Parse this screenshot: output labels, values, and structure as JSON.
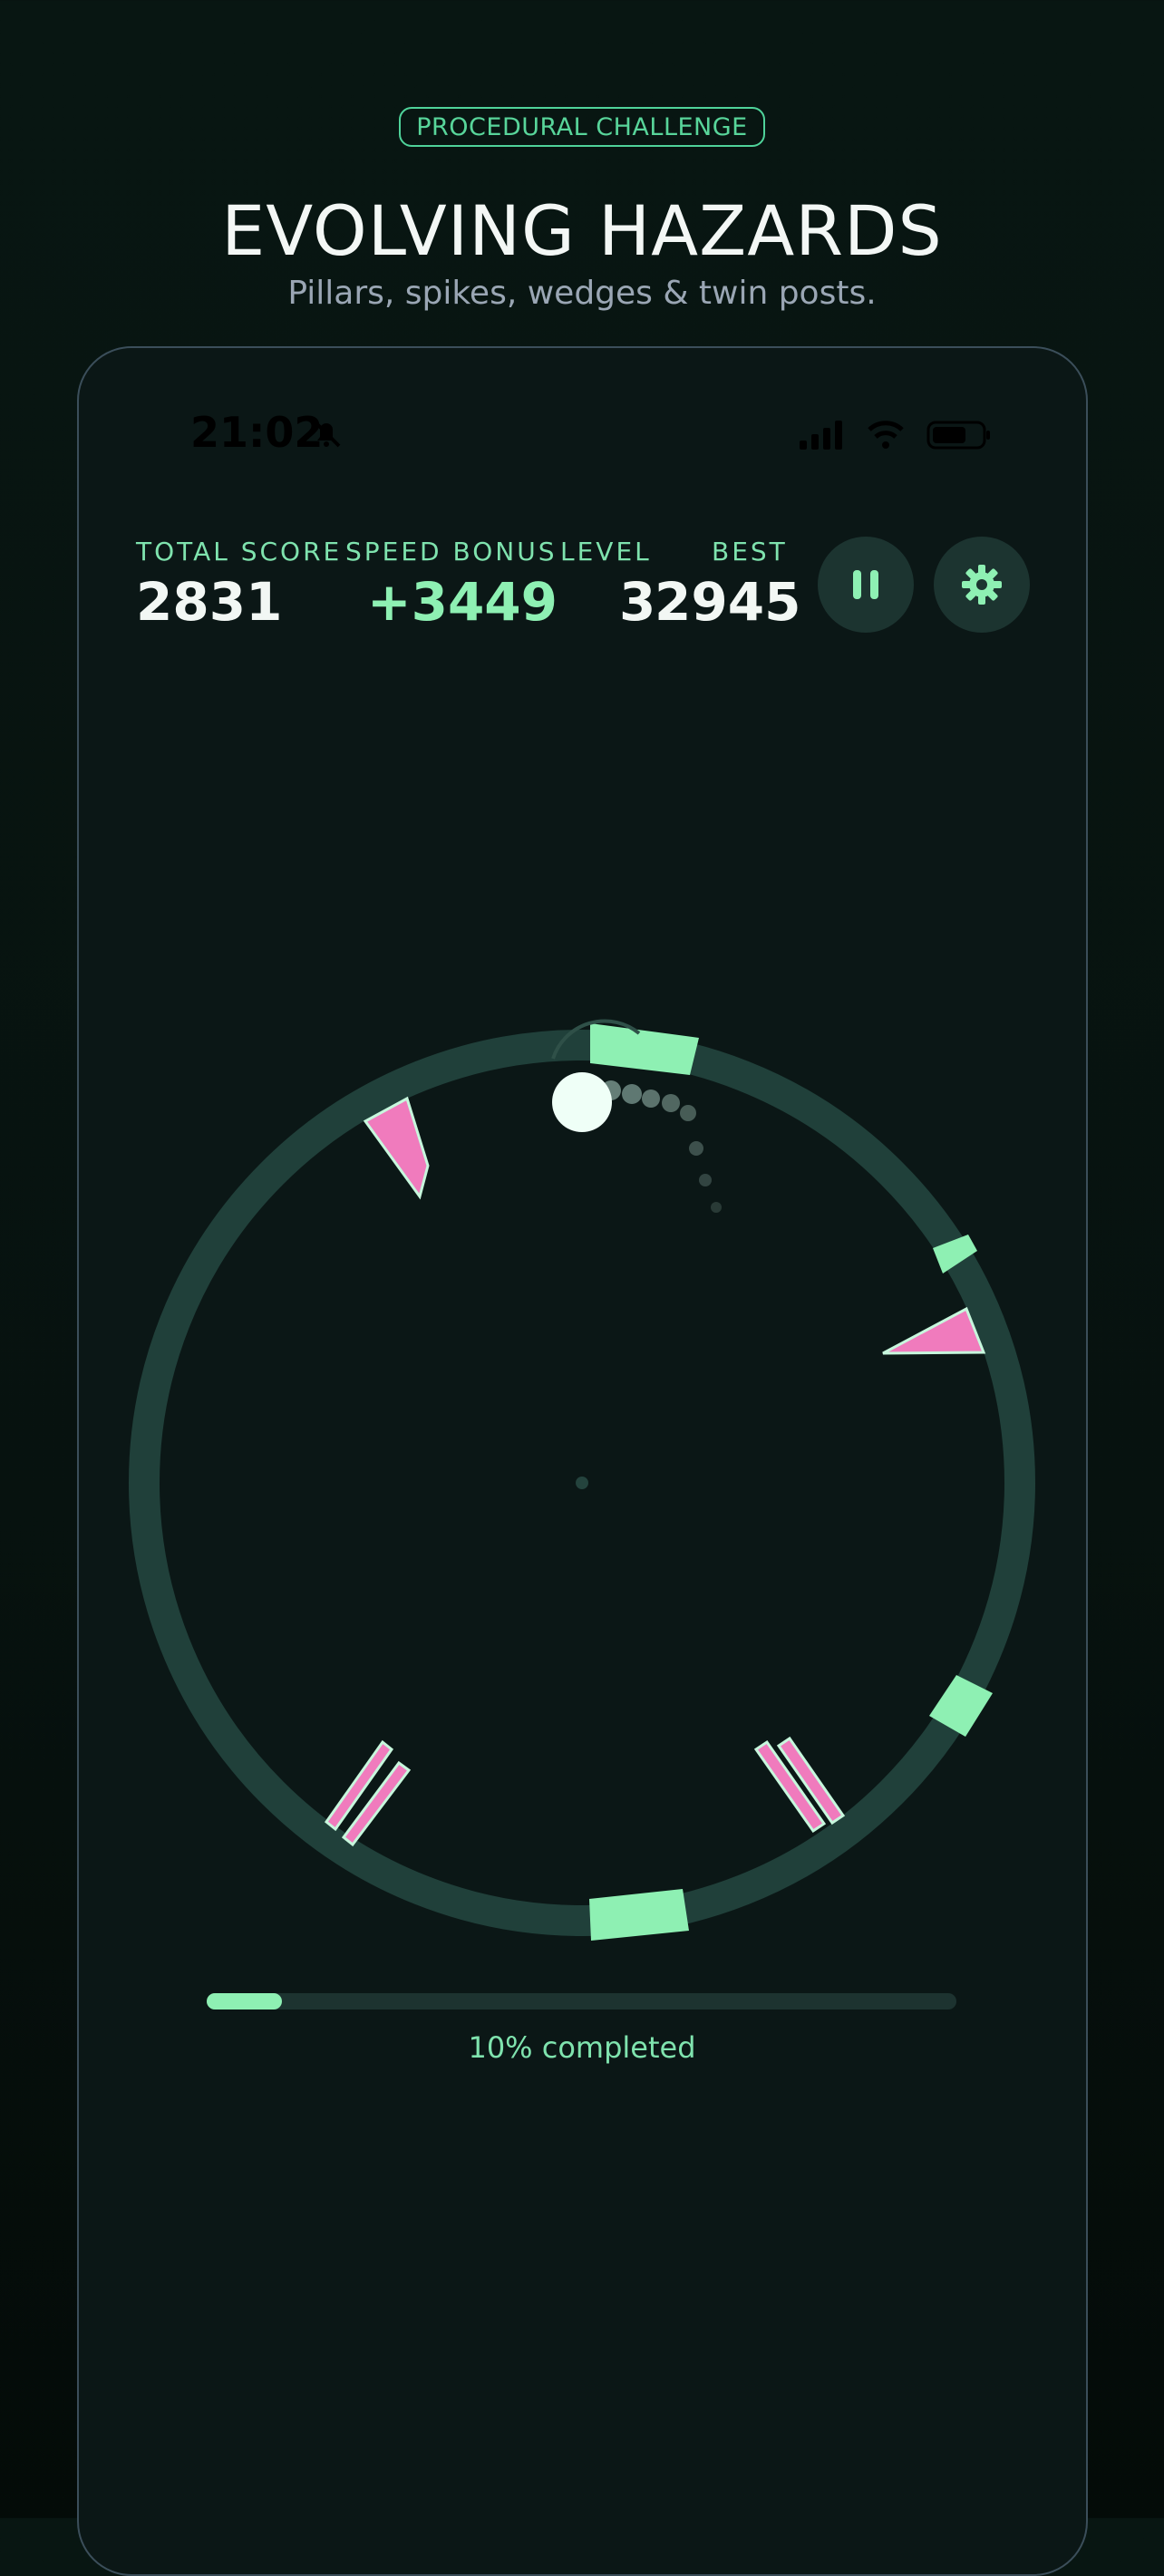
{
  "header": {
    "badge": "PROCEDURAL CHALLENGE",
    "title": "EVOLVING HAZARDS",
    "subtitle": "Pillars, spikes, wedges & twin posts."
  },
  "status_bar": {
    "time": "21:02",
    "icons": [
      "bell-off-icon",
      "signal-icon",
      "wifi-icon",
      "battery-icon"
    ]
  },
  "hud": {
    "total_score_label": "TOTAL SCORE",
    "total_score": "2831",
    "speed_bonus_label": "SPEED BONUS",
    "speed_bonus": "+3449",
    "level_label": "LEVEL",
    "level": "3",
    "best_label": "BEST",
    "best": "2945",
    "pause_icon": "pause-icon",
    "settings_icon": "gear-icon"
  },
  "game": {
    "ring_color": "#20403a",
    "safe_color": "#8ef0b3",
    "hazard_color": "#f07bbd",
    "ball_color": "#effff7"
  },
  "progress": {
    "fraction": 0.1,
    "label": "10% completed"
  }
}
